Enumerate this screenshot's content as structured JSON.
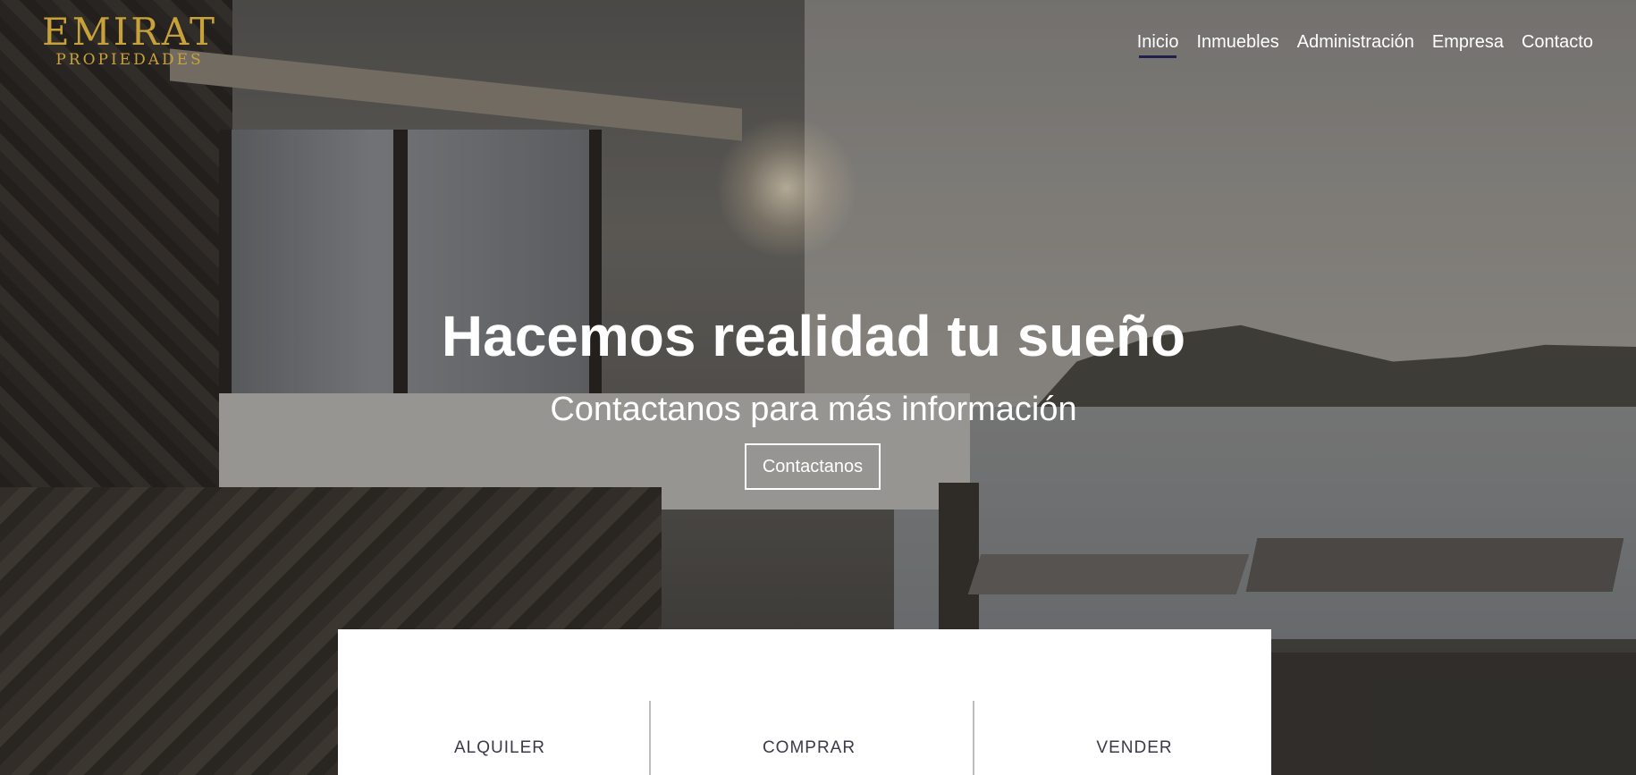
{
  "brand": {
    "name": "EMIRAT",
    "subtitle": "PROPIEDADES",
    "color": "#c9a13b"
  },
  "nav": {
    "items": [
      {
        "label": "Inicio",
        "active": true
      },
      {
        "label": "Inmuebles",
        "active": false
      },
      {
        "label": "Administración",
        "active": false
      },
      {
        "label": "Empresa",
        "active": false
      },
      {
        "label": "Contacto",
        "active": false
      }
    ],
    "active_underline_color": "#1f1f4d"
  },
  "hero": {
    "title": "Hacemos realidad tu sueño",
    "subtitle": "Contactanos para más información",
    "button_label": "Contactanos"
  },
  "services": {
    "items": [
      {
        "label": "ALQUILER"
      },
      {
        "label": "COMPRAR"
      },
      {
        "label": "VENDER"
      }
    ]
  }
}
